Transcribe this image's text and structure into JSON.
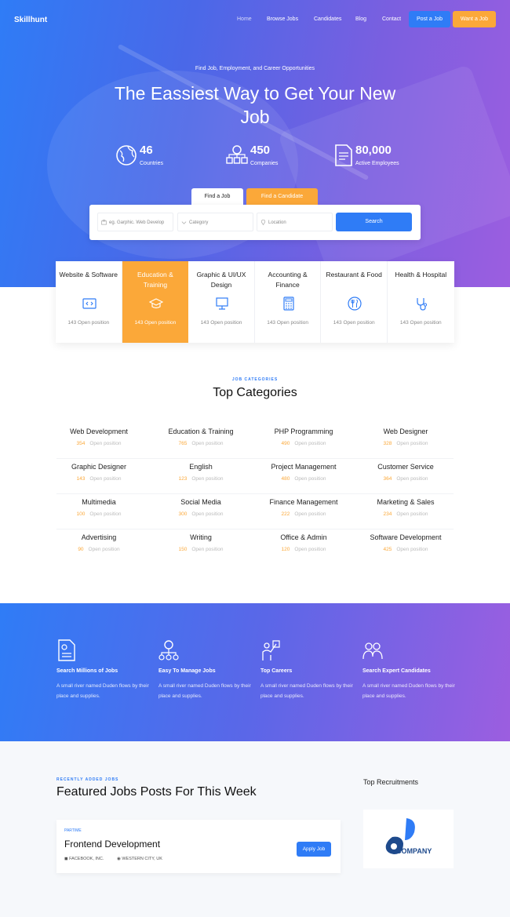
{
  "nav": {
    "logo": "Skillhunt",
    "links": [
      "Home",
      "Browse Jobs",
      "Candidates",
      "Blog",
      "Contact"
    ],
    "post_job": "Post a Job",
    "want_job": "Want a Job"
  },
  "hero": {
    "tagline": "Find Job, Employment, and Career Opportunities",
    "title": "The Eassiest Way to Get Your New Job",
    "stats": [
      {
        "value": "46",
        "label": "Countries",
        "icon": "globe-icon"
      },
      {
        "value": "450",
        "label": "Companies",
        "icon": "companies-icon"
      },
      {
        "value": "80,000",
        "label": "Active Employees",
        "icon": "document-icon"
      }
    ],
    "tabs": [
      "Find a Job",
      "Find a Candidate"
    ],
    "search": {
      "keyword_value": "eg. Garphic. Web Develop",
      "category_placeholder": "Category",
      "location_placeholder": "Location",
      "button": "Search"
    }
  },
  "category_cards": [
    {
      "title": "Website & Software",
      "open": "143 Open position",
      "icon": "code-icon"
    },
    {
      "title": "Education & Training",
      "open": "143 Open position",
      "icon": "graduation-cap-icon",
      "active": true
    },
    {
      "title": "Graphic & UI/UX Design",
      "open": "143 Open position",
      "icon": "design-icon"
    },
    {
      "title": "Accounting & Finance",
      "open": "143 Open position",
      "icon": "calculator-icon"
    },
    {
      "title": "Restaurant & Food",
      "open": "143 Open position",
      "icon": "restaurant-icon"
    },
    {
      "title": "Health & Hospital",
      "open": "143 Open position",
      "icon": "stethoscope-icon"
    }
  ],
  "top_categories": {
    "kicker": "JOB CATEGORIES",
    "title": "Top Categories",
    "open_label": "Open position",
    "items": [
      {
        "name": "Web Development",
        "count": "354"
      },
      {
        "name": "Education & Training",
        "count": "765"
      },
      {
        "name": "PHP Programming",
        "count": "490"
      },
      {
        "name": "Web Designer",
        "count": "328"
      },
      {
        "name": "Graphic Designer",
        "count": "143"
      },
      {
        "name": "English",
        "count": "123"
      },
      {
        "name": "Project Management",
        "count": "480"
      },
      {
        "name": "Customer Service",
        "count": "364"
      },
      {
        "name": "Multimedia",
        "count": "100"
      },
      {
        "name": "Social Media",
        "count": "300"
      },
      {
        "name": "Finance Management",
        "count": "222"
      },
      {
        "name": "Marketing & Sales",
        "count": "234"
      },
      {
        "name": "Advertising",
        "count": "90"
      },
      {
        "name": "Writing",
        "count": "150"
      },
      {
        "name": "Office & Admin",
        "count": "120"
      },
      {
        "name": "Software Development",
        "count": "425"
      }
    ]
  },
  "features": [
    {
      "title": "Search Millions of Jobs",
      "desc": "A small river named Duden flows by their place and supplies.",
      "icon": "resume-icon"
    },
    {
      "title": "Easy To Manage Jobs",
      "desc": "A small river named Duden flows by their place and supplies.",
      "icon": "network-icon"
    },
    {
      "title": "Top Careers",
      "desc": "A small river named Duden flows by their place and supplies.",
      "icon": "career-icon"
    },
    {
      "title": "Search Expert Candidates",
      "desc": "A small river named Duden flows by their place and supplies.",
      "icon": "team-icon"
    }
  ],
  "featured_jobs": {
    "kicker": "RECENTLY ADDED JOBS",
    "title": "Featured Jobs Posts For This Week",
    "job": {
      "type": "PARTIME",
      "title": "Frontend Development",
      "company": "FACEBOOK, INC.",
      "location": "WESTERN CITY, UK",
      "apply": "Apply Job"
    }
  },
  "recruitments": {
    "title": "Top Recruitments",
    "company": "COMPANY"
  },
  "colors": {
    "primary": "#2f7cf6",
    "accent": "#fba839",
    "gradient_end": "#9c5ee0"
  }
}
